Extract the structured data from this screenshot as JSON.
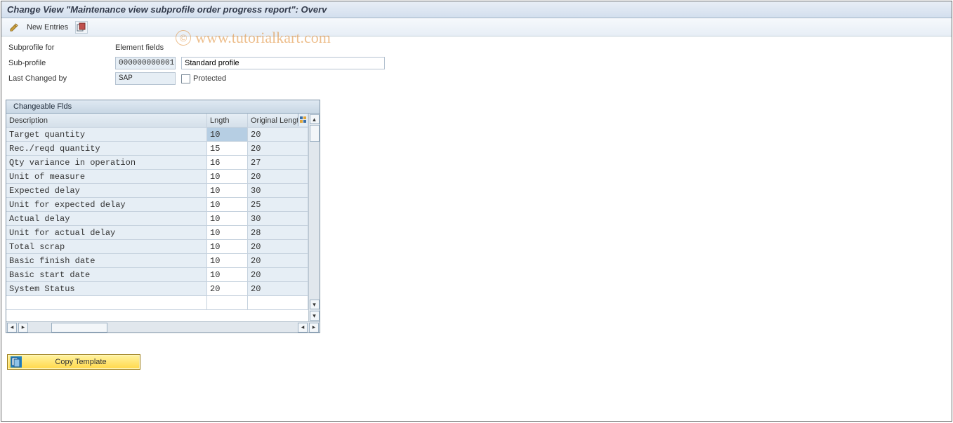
{
  "title": "Change View \"Maintenance view subprofile order progress report\": Overv",
  "toolbar": {
    "new_entries_label": "New Entries"
  },
  "watermark": "www.tutorialkart.com",
  "form": {
    "subprofile_for_label": "Subprofile for",
    "subprofile_for_value": "Element fields",
    "subprofile_label": "Sub-profile",
    "subprofile_value": "000000000001",
    "subprofile_desc": "Standard profile",
    "last_changed_label": "Last Changed by",
    "last_changed_value": "SAP",
    "protected_label": "Protected",
    "protected_checked": false
  },
  "table": {
    "caption": "Changeable Flds",
    "columns": {
      "desc": "Description",
      "len": "Lngth",
      "olen": "Original Length"
    },
    "rows": [
      {
        "desc": "Target quantity",
        "len": "10",
        "olen": "20",
        "sel": true
      },
      {
        "desc": "Rec./reqd quantity",
        "len": "15",
        "olen": "20"
      },
      {
        "desc": "Qty variance in operation",
        "len": "16",
        "olen": "27"
      },
      {
        "desc": "Unit of measure",
        "len": "10",
        "olen": "20"
      },
      {
        "desc": "Expected delay",
        "len": "10",
        "olen": "30"
      },
      {
        "desc": "Unit for expected delay",
        "len": "10",
        "olen": "25"
      },
      {
        "desc": "Actual delay",
        "len": "10",
        "olen": "30"
      },
      {
        "desc": "Unit for actual delay",
        "len": "10",
        "olen": "28"
      },
      {
        "desc": "Total scrap",
        "len": "10",
        "olen": "20"
      },
      {
        "desc": "Basic finish date",
        "len": "10",
        "olen": "20"
      },
      {
        "desc": "Basic start date",
        "len": "10",
        "olen": "20"
      },
      {
        "desc": "System Status",
        "len": "20",
        "olen": "20"
      }
    ]
  },
  "bottom_button": "Copy Template"
}
